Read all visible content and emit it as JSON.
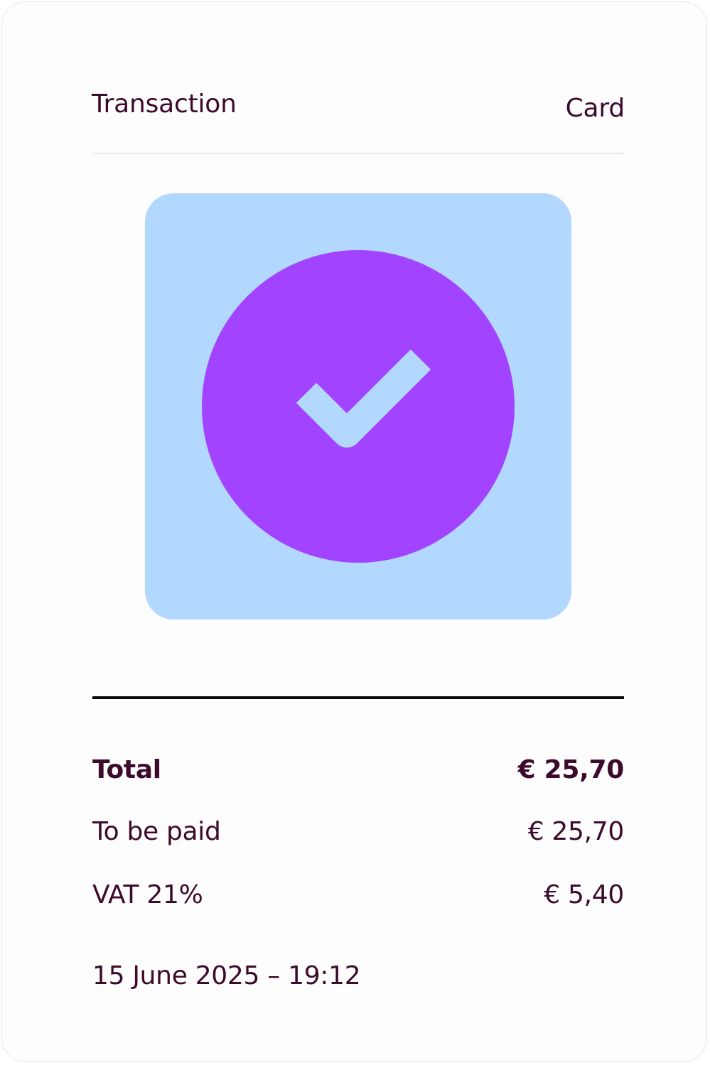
{
  "colors": {
    "text": "#3d0a2b",
    "tile_background": "#b3d8ff",
    "check_circle": "#a243ff",
    "check_mark": "#b3d8ff",
    "divider_light": "#e8e6e8",
    "divider_dark": "#0a0a0a"
  },
  "header": {
    "title": "Transaction",
    "payment_method": "Card"
  },
  "status": {
    "icon": "check-circle-icon"
  },
  "summary": {
    "total_label": "Total",
    "total_value": "€ 25,70",
    "to_be_paid_label": "To be paid",
    "to_be_paid_value": "€ 25,70",
    "vat_label": "VAT 21%",
    "vat_value": "€ 5,40"
  },
  "timestamp": "15 June 2025 – 19:12"
}
